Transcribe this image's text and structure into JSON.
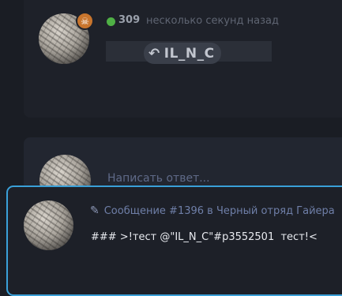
{
  "post": {
    "score": "309",
    "time": "несколько секунд назад",
    "reply_to": "IL_N_C",
    "status_color": "#4fb045",
    "badge_icon": "skull-icon"
  },
  "compose": {
    "placeholder": "Написать ответ..."
  },
  "popup": {
    "meta": "Сообщение #1396 в Черный отряд Гайера",
    "text": "### >!тест @\"IL_N_C\"#p3552501  тест!<",
    "border_color": "#3aa0d8"
  }
}
